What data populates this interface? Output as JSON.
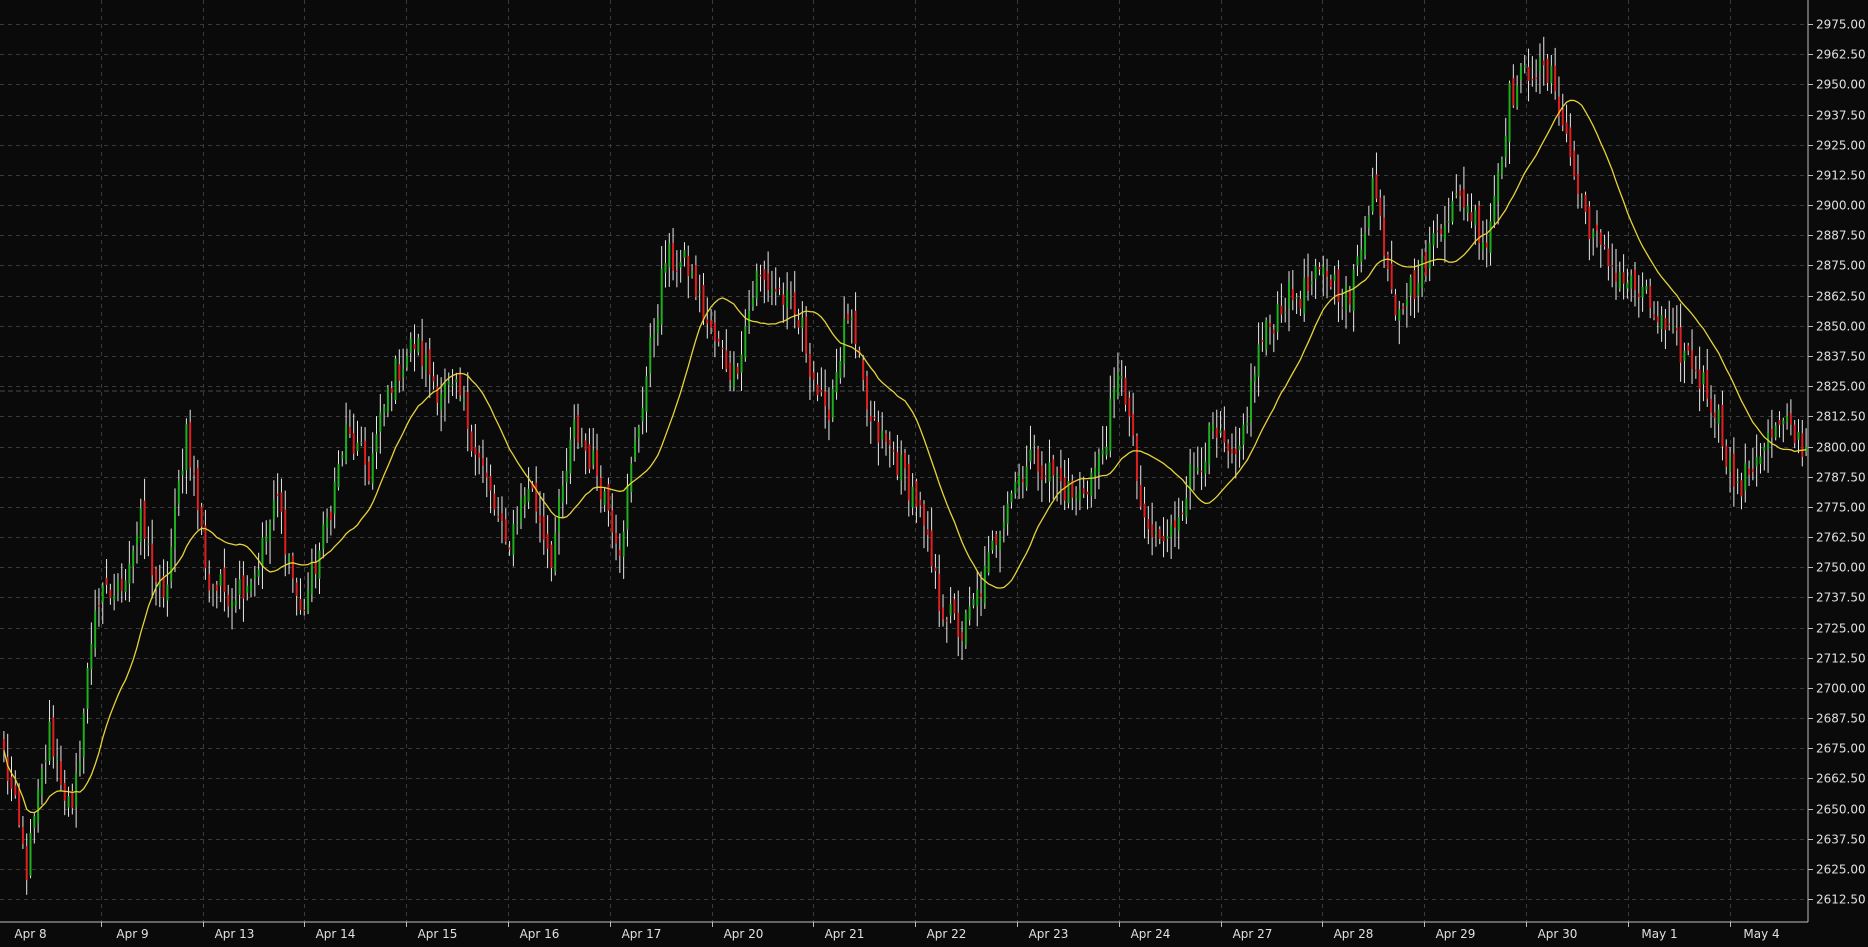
{
  "chart_data": {
    "type": "candlestick",
    "title": "",
    "xlabel": "",
    "ylabel": "",
    "ylim": [
      2603,
      2985
    ],
    "y_ticks": [
      "2975.00",
      "2962.50",
      "2950.00",
      "2937.50",
      "2925.00",
      "2912.50",
      "2900.00",
      "2887.50",
      "2875.00",
      "2862.50",
      "2850.00",
      "2837.50",
      "2825.00",
      "2812.50",
      "2800.00",
      "2787.50",
      "2775.00",
      "2762.50",
      "2750.00",
      "2737.50",
      "2725.00",
      "2712.50",
      "2700.00",
      "2687.50",
      "2675.00",
      "2662.50",
      "2650.00",
      "2637.50",
      "2625.00",
      "2612.50"
    ],
    "x_ticks": [
      "Apr 8",
      "Apr 9",
      "Apr 13",
      "Apr 14",
      "Apr 15",
      "Apr 16",
      "Apr 17",
      "Apr 20",
      "Apr 21",
      "Apr 22",
      "Apr 23",
      "Apr 24",
      "Apr 27",
      "Apr 28",
      "Apr 29",
      "Apr 30",
      "May 1",
      "May 4"
    ],
    "grid": true,
    "moving_average_color": "#e6d23a",
    "up_color": "#1fae1f",
    "down_color": "#e02020",
    "wick_color": "#e8e8e8",
    "price_path": [
      2672,
      2625,
      2682,
      2645,
      2735,
      2740,
      2768,
      2733,
      2808,
      2742,
      2740,
      2748,
      2778,
      2730,
      2762,
      2805,
      2790,
      2828,
      2843,
      2825,
      2820,
      2790,
      2758,
      2785,
      2755,
      2807,
      2790,
      2760,
      2820,
      2878,
      2874,
      2846,
      2830,
      2870,
      2864,
      2848,
      2810,
      2855,
      2808,
      2797,
      2778,
      2736,
      2722,
      2746,
      2780,
      2797,
      2788,
      2778,
      2793,
      2833,
      2764,
      2760,
      2788,
      2805,
      2790,
      2840,
      2860,
      2864,
      2872,
      2860,
      2910,
      2860,
      2868,
      2895,
      2903,
      2885,
      2945,
      2958,
      2950,
      2905,
      2880,
      2870,
      2860,
      2845,
      2835,
      2817,
      2780,
      2800,
      2808,
      2800
    ],
    "candles_per_segment": 6,
    "ma_period": 20
  }
}
